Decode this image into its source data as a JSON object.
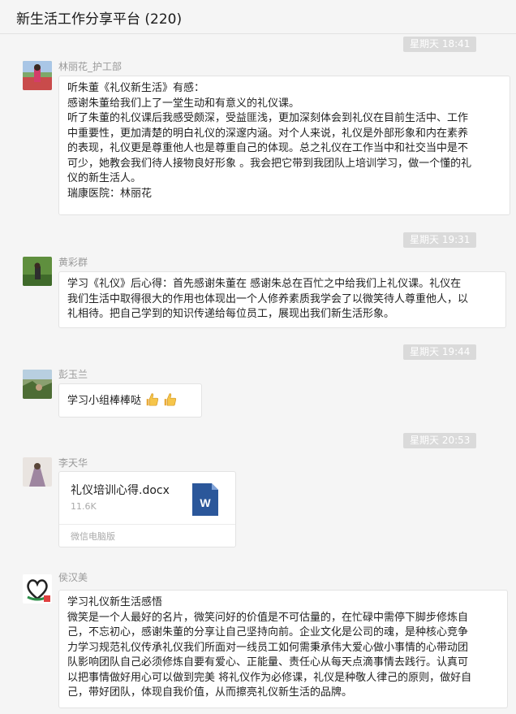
{
  "header": {
    "title": "新生活工作分享平台 (220)"
  },
  "messages": [
    {
      "time": "星期天 18:41",
      "sender": "林丽花_护工部",
      "lines": [
        "听朱董《礼仪新生活》有感：",
        "感谢朱董给我们上了一堂生动和有意义的礼仪课。",
        "听了朱董的礼仪课后我感受颇深，受益匪浅，更加深刻体会到礼仪在目前生活中、工作",
        "中重要性，更加清楚的明白礼仪的深邃内涵。对个人来说，礼仪是外部形象和内在素养",
        "的表现，礼仪更是尊重他人也是尊重自己的体现。总之礼仪在工作当中和社交当中是不",
        "可少，她教会我们待人接物良好形象 。我会把它带到我团队上培训学习，做一个懂的礼",
        "仪的新生活人。",
        "瑞康医院：林丽花"
      ]
    },
    {
      "time": "星期天 19:31",
      "sender": "黄彩群",
      "lines": [
        "学习《礼仪》后心得：首先感谢朱董在  感谢朱总在百忙之中给我们上礼仪课。礼仪在",
        "我们生活中取得很大的作用也体现出一个人修养素质我学会了以微笑待人尊重他人，以",
        "礼相待。把自己学到的知识传递给每位员工，展现出我们新生活形象。"
      ]
    },
    {
      "time": "星期天 19:44",
      "sender": "彭玉兰",
      "text": "学习小组棒棒哒",
      "emoji": [
        "thumbs-up-icon",
        "thumbs-up-icon"
      ]
    },
    {
      "time": "星期天 20:53",
      "sender": "李天华",
      "file": {
        "name": "礼仪培训心得.docx",
        "size": "11.6K",
        "source": "微信电脑版",
        "icon": "word-document-icon",
        "icon_letter": "W"
      }
    },
    {
      "sender": "侯汉美",
      "lines": [
        "学习礼仪新生活感悟",
        "微笑是一个人最好的名片，微笑问好的价值是不可估量的，在忙碌中需停下脚步修炼自",
        "己，不忘初心，感谢朱董的分享让自己坚持向前。企业文化是公司的魂，是种核心竞争",
        "力学习规范礼仪传承礼仪我们所面对一线员工如何需秉承伟大爱心做小事情的心带动团",
        "队影响团队自己必须修炼自要有爱心、正能量、责任心从每天点滴事情去践行。认真可",
        "以把事情做好用心可以做到完美 将礼仪作为必修课，礼仪是种敬人律己的原则，做好自",
        "己，带好团队，体现自我价值，从而擦亮礼仪新生活的品牌。"
      ]
    }
  ],
  "colors": {
    "background": "#f5f5f5",
    "time_badge": "#dadada",
    "word_blue": "#2b579a"
  }
}
